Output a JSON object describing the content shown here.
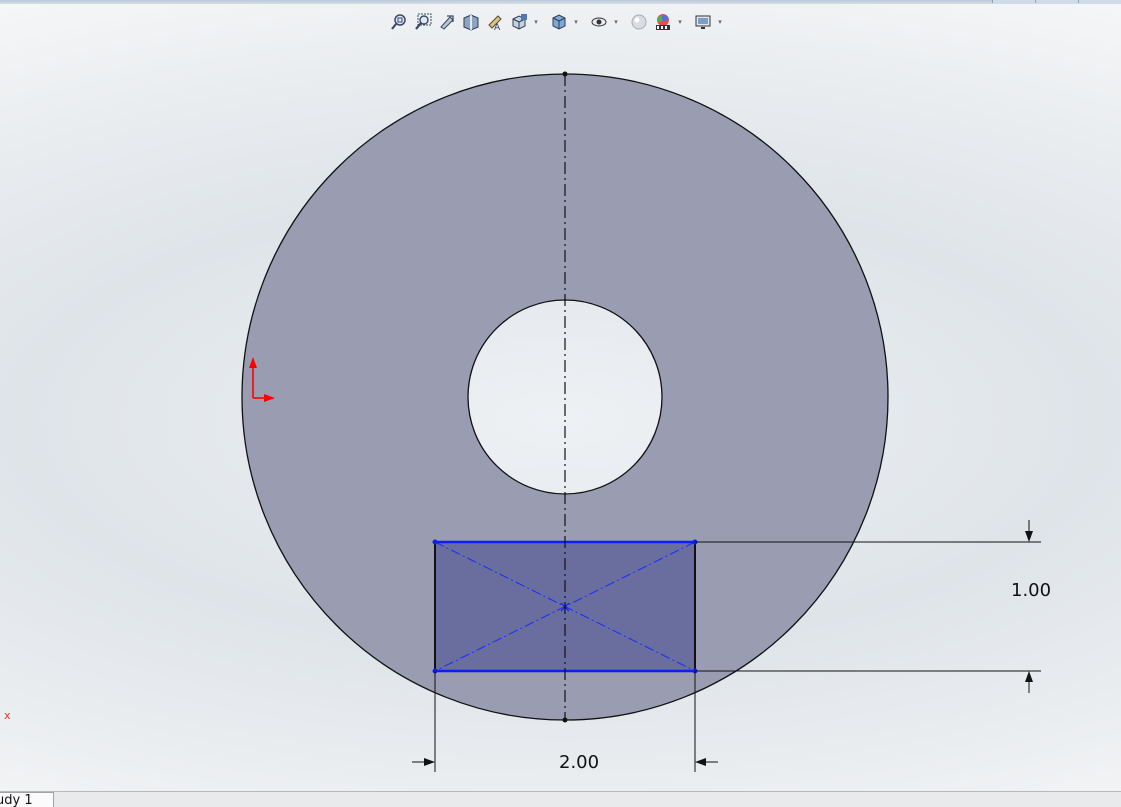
{
  "toolbar": {
    "items": [
      {
        "icon": "zoom-to-fit-icon"
      },
      {
        "icon": "zoom-to-area-icon"
      },
      {
        "icon": "previous-view-icon"
      },
      {
        "icon": "section-view-icon"
      },
      {
        "icon": "dynamic-annotation-views-icon"
      },
      {
        "icon": "view-orientation-icon",
        "dropdown": true
      },
      {
        "icon": "display-style-icon",
        "dropdown": true
      },
      {
        "icon": "hide-show-items-icon",
        "dropdown": true
      },
      {
        "icon": "edit-appearance-icon"
      },
      {
        "icon": "apply-scene-icon",
        "dropdown": true
      },
      {
        "icon": "view-settings-icon",
        "dropdown": true
      }
    ]
  },
  "sketch": {
    "dimensions": {
      "width_value": "2.00",
      "height_value": "1.00"
    },
    "colors": {
      "part_fill": "#9a9db1",
      "rectangle_fill": "#6a6e9f",
      "selected_lines": "#0a1ff0",
      "origin": "#ff0000"
    }
  },
  "status": {
    "coord_marker": "x"
  },
  "bottom_tabs": [
    {
      "label": "udy 1"
    }
  ]
}
